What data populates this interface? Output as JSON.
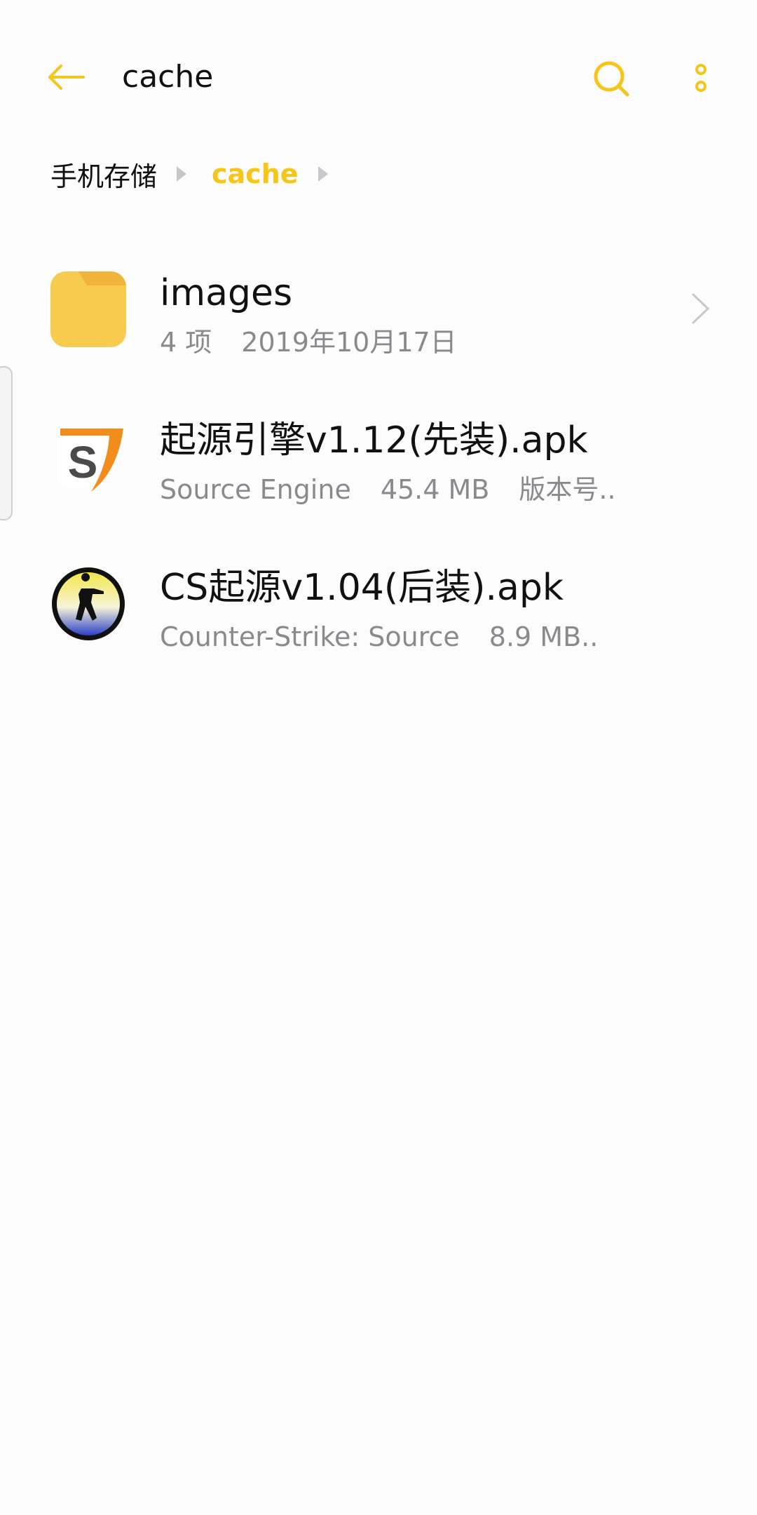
{
  "appbar": {
    "title": "cache",
    "back_icon": "back-arrow-icon",
    "search_icon": "search-icon",
    "more_icon": "more-vertical-icon",
    "accent_color": "#F5C518"
  },
  "breadcrumb": {
    "items": [
      {
        "label": "手机存储"
      },
      {
        "label": "cache"
      }
    ]
  },
  "files": [
    {
      "name": "images",
      "type": "folder",
      "icon": "folder-icon",
      "meta": [
        "4 项",
        "2019年10月17日"
      ],
      "has_chevron": true
    },
    {
      "name": "起源引擎v1.12(先装).apk",
      "type": "apk",
      "icon": "source-engine-app-icon",
      "meta": [
        "Source Engine",
        "45.4 MB",
        "版本号.."
      ]
    },
    {
      "name": "CS起源v1.04(后装).apk",
      "type": "apk",
      "icon": "counter-strike-app-icon",
      "meta": [
        "Counter-Strike: Source",
        "8.9 MB.."
      ]
    }
  ]
}
